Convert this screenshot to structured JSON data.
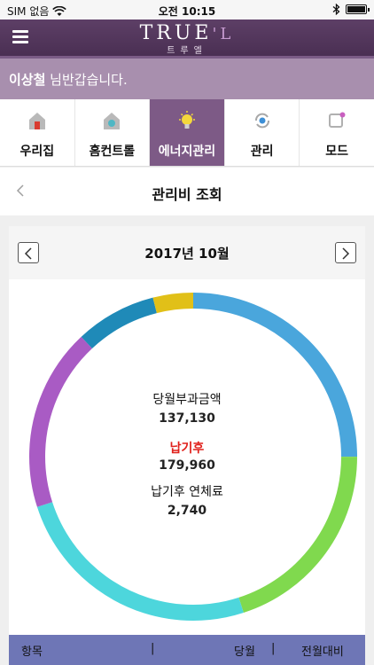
{
  "status": {
    "carrier": "SIM 없음",
    "time": "오전 10:15"
  },
  "app": {
    "logo_main": "TRUE",
    "logo_accent": "'L",
    "logo_sub": "트루엘"
  },
  "greeting": {
    "name": "이상철",
    "suffix": " 님반갑습니다."
  },
  "tabs": [
    {
      "label": "우리집",
      "icon": "house-icon"
    },
    {
      "label": "홈컨트롤",
      "icon": "home-control-icon"
    },
    {
      "label": "에너지관리",
      "icon": "lightbulb-icon"
    },
    {
      "label": "관리",
      "icon": "settings-cycle-icon"
    },
    {
      "label": "모드",
      "icon": "mode-icon"
    }
  ],
  "header": {
    "title": "관리비 조회"
  },
  "month": "2017년 10월",
  "summary": {
    "charge_label": "당월부과금액",
    "charge_value": "137,130",
    "after_label": "납기후",
    "after_value": "179,960",
    "late_label": "납기후 연체료",
    "late_value": "2,740"
  },
  "donut": {
    "segments": [
      {
        "color": "#4aa6dc",
        "fraction": 0.25
      },
      {
        "color": "#80d94e",
        "fraction": 0.2
      },
      {
        "color": "#4dd6dc",
        "fraction": 0.25
      },
      {
        "color": "#a95bc4",
        "fraction": 0.18
      },
      {
        "color": "#1f8ab8",
        "fraction": 0.08
      },
      {
        "color": "#e1c018",
        "fraction": 0.04
      }
    ]
  },
  "table": {
    "col1": "항목",
    "sep1": "|",
    "col2": "당월",
    "sep2": "|",
    "col3": "전월대비"
  }
}
